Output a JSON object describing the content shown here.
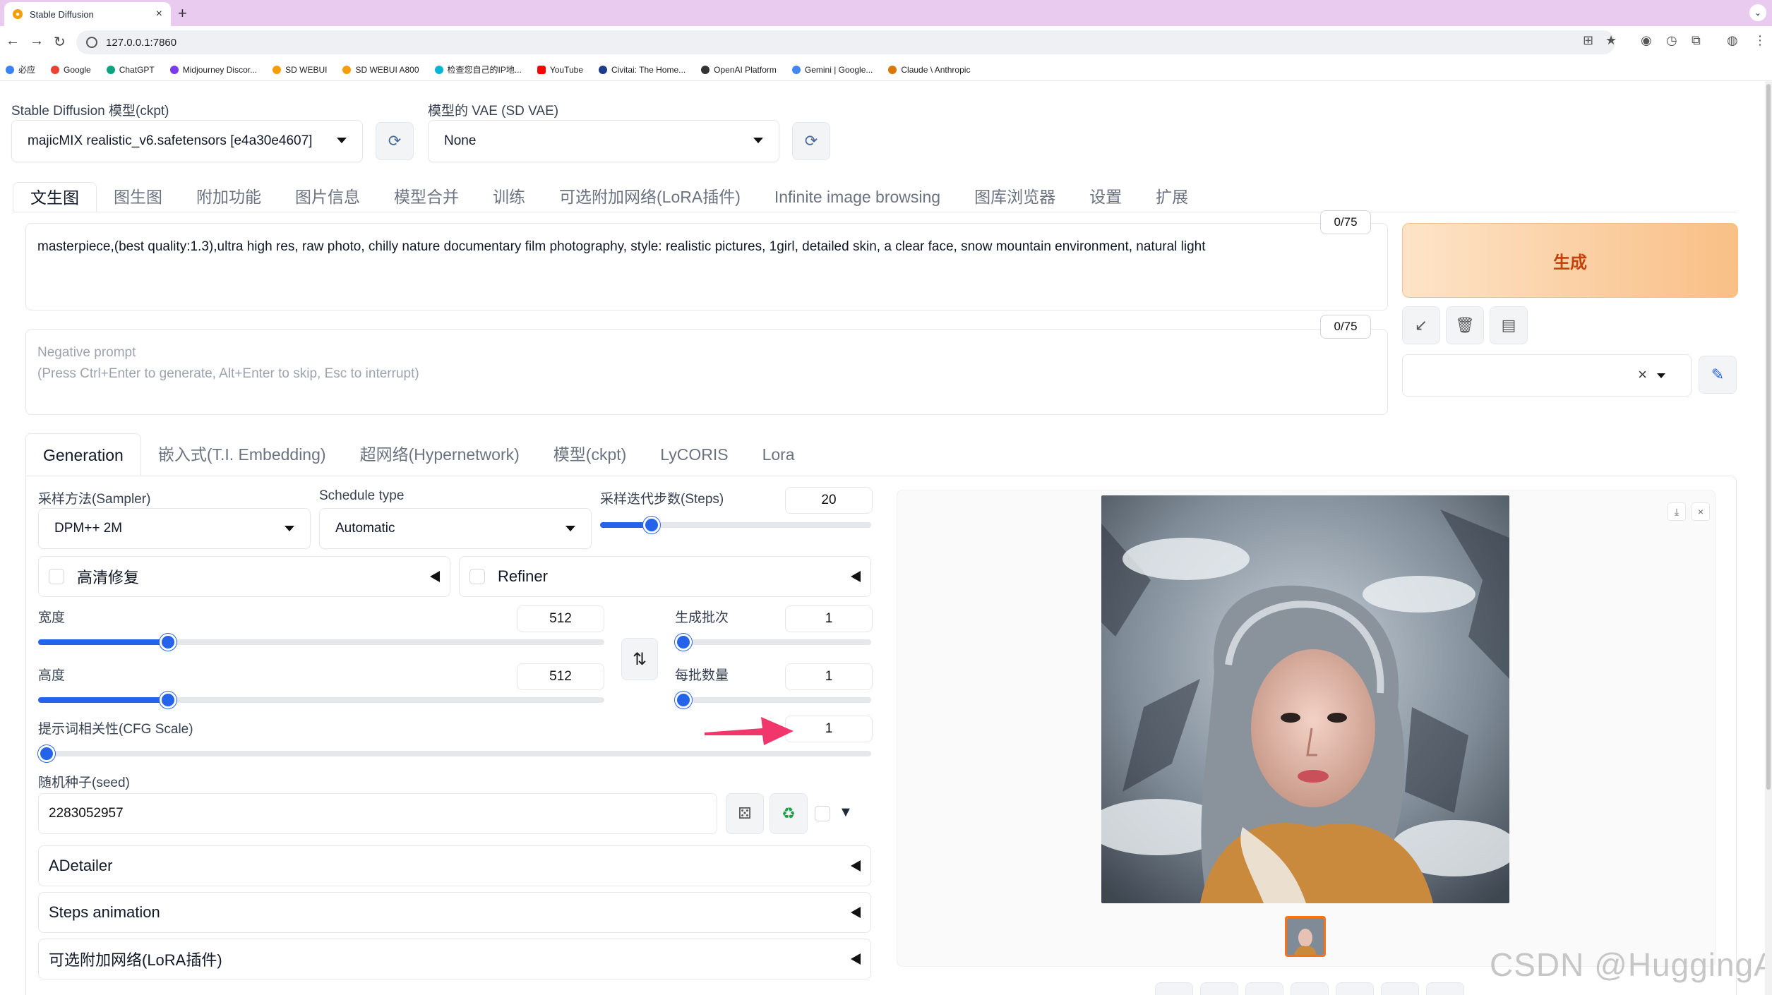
{
  "browser": {
    "tab_title": "Stable Diffusion",
    "url": "127.0.0.1:7860",
    "bookmarks": [
      "必应",
      "Google",
      "ChatGPT",
      "Midjourney Discor...",
      "SD WEBUI",
      "SD WEBUI A800",
      "检查您自己的IP地...",
      "YouTube",
      "Civitai: The Home...",
      "OpenAI Platform",
      "Gemini | Google...",
      "Claude \\ Anthropic"
    ]
  },
  "model": {
    "ckpt_label": "Stable Diffusion 模型(ckpt)",
    "ckpt_value": "majicMIX realistic_v6.safetensors [e4a30e4607]",
    "vae_label": "模型的 VAE (SD VAE)",
    "vae_value": "None"
  },
  "main_tabs": [
    "文生图",
    "图生图",
    "附加功能",
    "图片信息",
    "模型合并",
    "训练",
    "可选附加网络(LoRA插件)",
    "Infinite image browsing",
    "图库浏览器",
    "设置",
    "扩展"
  ],
  "prompt": {
    "text": "masterpiece,(best quality:1.3),ultra high res, raw photo, chilly nature documentary film photography, style: realistic pictures, 1girl, detailed skin, a clear face, snow mountain environment, natural light",
    "counter": "0/75",
    "negative_placeholder_1": "Negative prompt",
    "negative_placeholder_2": "(Press Ctrl+Enter to generate, Alt+Enter to skip, Esc to interrupt)",
    "negative_counter": "0/75"
  },
  "generate_label": "生成",
  "sub_tabs": [
    "Generation",
    "嵌入式(T.I. Embedding)",
    "超网络(Hypernetwork)",
    "模型(ckpt)",
    "LyCORIS",
    "Lora"
  ],
  "generation": {
    "sampler_label": "采样方法(Sampler)",
    "sampler_value": "DPM++ 2M",
    "schedule_label": "Schedule type",
    "schedule_value": "Automatic",
    "steps_label": "采样迭代步数(Steps)",
    "steps_value": "20",
    "steps_fraction": 0.19,
    "hires_label": "高清修复",
    "refiner_label": "Refiner",
    "width_label": "宽度",
    "width_value": "512",
    "width_fraction": 0.23,
    "height_label": "高度",
    "height_value": "512",
    "height_fraction": 0.23,
    "batch_count_label": "生成批次",
    "batch_count_value": "1",
    "batch_size_label": "每批数量",
    "batch_size_value": "1",
    "cfg_label": "提示词相关性(CFG Scale)",
    "cfg_value": "1",
    "cfg_fraction": 0.0,
    "seed_label": "随机种子(seed)",
    "seed_value": "2283052957",
    "accordions": [
      "ADetailer",
      "Steps animation",
      "可选附加网络(LoRA插件)"
    ]
  },
  "colors": {
    "accent": "#2563eb",
    "generate_text": "#c2410c",
    "annotation_arrow": "#f0366a"
  },
  "watermark": "CSDN @HuggingAI"
}
